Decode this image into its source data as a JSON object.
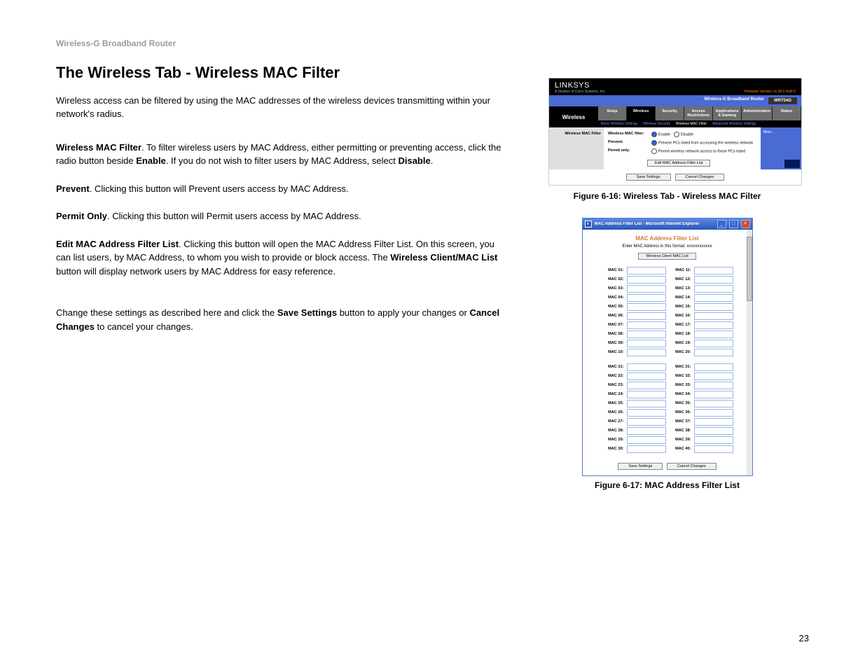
{
  "header": "Wireless-G Broadband Router",
  "title": "The Wireless Tab - Wireless MAC Filter",
  "intro": "Wireless access can be filtered by using the MAC addresses of the wireless devices transmitting within your network's radius.",
  "p_filter_b": "Wireless MAC Filter",
  "p_filter_t": ". To filter wireless users by MAC Address, either permitting or preventing access, click the radio button beside ",
  "p_filter_b2": "Enable",
  "p_filter_t2": ". If you do not wish to filter users by MAC Address, select ",
  "p_filter_b3": "Disable",
  "p_filter_t3": ".",
  "p_prevent_b": "Prevent",
  "p_prevent_t": ". Clicking this button will Prevent users access by MAC Address.",
  "p_permit_b": "Permit Only",
  "p_permit_t": ". Clicking this button will Permit users access by MAC Address.",
  "p_edit_b": "Edit MAC Address Filter List",
  "p_edit_t1": ". Clicking this button will open the MAC Address Filter List. On this screen, you can list users, by MAC Address, to whom you wish to provide or block access. The ",
  "p_edit_b2": "Wireless Client/MAC List",
  "p_edit_t2": " button will display network users by MAC Address for easy reference.",
  "p_save_t1": "Change these settings as described here and click the ",
  "p_save_b1": "Save Settings",
  "p_save_t2": " button to apply your changes or ",
  "p_save_b2": "Cancel Changes",
  "p_save_t3": " to cancel your changes.",
  "pagenum": "23",
  "fig1": {
    "logo": "LINKSYS",
    "logo_sub": "A Division of Cisco Systems, Inc.",
    "firmware": "Firmware Version: v1.00.0 draft 0",
    "product": "Wireless-G Broadband Router",
    "model": "WRT54G",
    "sidelabel": "Wireless",
    "tabs": [
      "Setup",
      "Wireless",
      "Security",
      "Access Restrictions",
      "Applications & Gaming",
      "Administration",
      "Status"
    ],
    "subtabs": [
      "Basic Wireless Settings",
      "Wireless Security",
      "Wireless MAC Filter",
      "Advanced Wireless Settings"
    ],
    "leftlabel": "Wireless MAC Filter",
    "row_filter": "Wireless MAC filter:",
    "opt_enable": "Enable",
    "opt_disable": "Disable",
    "row_prevent_label": "Prevent:",
    "row_prevent_text": "Prevent PCs listed from accessing the wireless network",
    "row_permit_label": "Permit only:",
    "row_permit_text": "Permit wireless network access to those PCs listed",
    "editbtn": "Edit MAC Address Filter List",
    "more": "More...",
    "save": "Save Settings",
    "cancel": "Cancel Changes",
    "caption": "Figure 6-16: Wireless Tab - Wireless MAC Filter"
  },
  "fig2": {
    "wintitle": "MAC Address Filter List - Microsoft Internet Explorer",
    "heading": "MAC Address Filter List",
    "subhead": "Enter MAC Address in this format: xxxxxxxxxxxx",
    "wcbtn": "Wireless Client MAC List",
    "group1_left": [
      "MAC 01:",
      "MAC 02:",
      "MAC 03:",
      "MAC 04:",
      "MAC 05:",
      "MAC 06:",
      "MAC 07:",
      "MAC 08:",
      "MAC 09:",
      "MAC 10:"
    ],
    "group1_right": [
      "MAC 11:",
      "MAC 12:",
      "MAC 13:",
      "MAC 14:",
      "MAC 15:",
      "MAC 16:",
      "MAC 17:",
      "MAC 18:",
      "MAC 19:",
      "MAC 20:"
    ],
    "group2_left": [
      "MAC 21:",
      "MAC 22:",
      "MAC 23:",
      "MAC 24:",
      "MAC 25:",
      "MAC 26:",
      "MAC 27:",
      "MAC 28:",
      "MAC 29:",
      "MAC 30:"
    ],
    "group2_right": [
      "MAC 31:",
      "MAC 32:",
      "MAC 33:",
      "MAC 34:",
      "MAC 35:",
      "MAC 36:",
      "MAC 37:",
      "MAC 38:",
      "MAC 39:",
      "MAC 40:"
    ],
    "save": "Save Settings",
    "cancel": "Cancel Changes",
    "caption": "Figure 6-17: MAC Address Filter List"
  }
}
